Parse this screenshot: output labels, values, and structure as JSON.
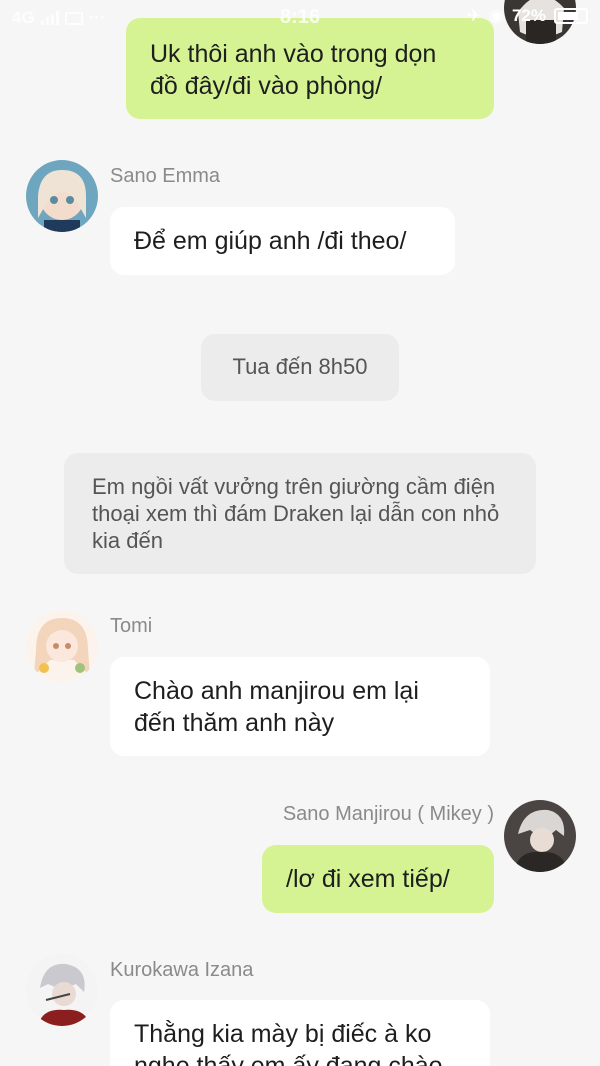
{
  "status_bar": {
    "network": "4G",
    "time": "8:16",
    "battery": "72%"
  },
  "messages": {
    "m1": {
      "text": "Uk thôi anh vào trong dọn đồ đây/đi vào phòng/"
    },
    "m2": {
      "sender": "Sano Emma",
      "text": "Để em giúp anh /đi theo/"
    },
    "m3": {
      "text": "Tua đến 8h50"
    },
    "m4": {
      "text": "Em ngồi vất vưởng trên giường cầm điện thoại xem thì đám Draken lại dẫn con nhỏ kia đến"
    },
    "m5": {
      "sender": "Tomi",
      "text": "Chào anh manjirou em lại đến thăm anh này"
    },
    "m6": {
      "sender": "Sano Manjirou ( Mikey )",
      "text": "/lơ đi xem tiếp/"
    },
    "m7": {
      "sender": "Kurokawa Izana",
      "text": "Thằng kia mày bị điếc à ko nghe thấy em ấy đang chào"
    }
  },
  "colors": {
    "background": "#f6f6f6",
    "incoming_bubble": "#ffffff",
    "outgoing_bubble": "#d5f393",
    "narration_bubble": "#ececec",
    "sender_name": "#8a8a8a"
  },
  "icons": [
    "signal-icon",
    "message-icon",
    "airplane-icon",
    "wifi-icon",
    "battery-icon"
  ]
}
